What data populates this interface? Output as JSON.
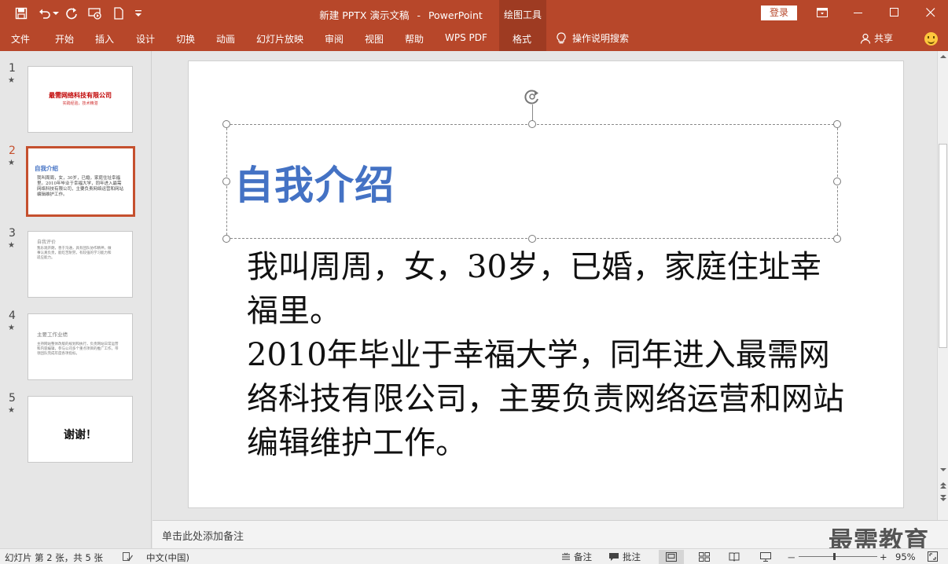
{
  "titlebar": {
    "doc_name": "新建 PPTX 演示文稿",
    "separator": "-",
    "app_name": "PowerPoint",
    "contextual_group": "绘图工具",
    "login_label": "登录"
  },
  "ribbon": {
    "tabs": [
      "文件",
      "开始",
      "插入",
      "设计",
      "切换",
      "动画",
      "幻灯片放映",
      "审阅",
      "视图",
      "帮助",
      "WPS PDF",
      "格式"
    ],
    "active_tab": "格式",
    "search_label": "操作说明搜索",
    "share_label": "共享"
  },
  "thumbnails": [
    {
      "number": "1",
      "star": "★",
      "title": "最需网络科技有限公司",
      "subtitle": "实践经验，技术精湛"
    },
    {
      "number": "2",
      "star": "★",
      "title": "自我介绍",
      "body": "我叫周周，女，30岁，已婚，家庭住址幸福里。2010年毕业于幸福大学，同年进入最需网络科技有限公司，主要负责网络运营和网站编辑维护工作。"
    },
    {
      "number": "3",
      "star": "★",
      "title": "自我评价",
      "body": "我乐观开朗，善于沟通，具有团队协作精神，做事认真负责，能吃苦耐劳，有较强的学习能力和适应能力。"
    },
    {
      "number": "4",
      "star": "★",
      "title": "主要工作业绩",
      "body": "主持网站整体改版的规划和执行，负责网站日常运营和内容编辑，参与公司多个重点项目的推广工作，带领团队完成年度各项指标。"
    },
    {
      "number": "5",
      "star": "★",
      "title": "谢谢！"
    }
  ],
  "slide": {
    "title": "自我介绍",
    "body_line1": "我叫周周，女，30岁，已婚，家庭住址幸福里。",
    "body_line2": "2010年毕业于幸福大学，同年进入最需网络科技有限公司，主要负责网络运营和网站编辑维护工作。",
    "title_color": "#4472c4"
  },
  "notes": {
    "placeholder": "单击此处添加备注",
    "watermark": "最需教育"
  },
  "statusbar": {
    "slide_info": "幻灯片 第 2 张，共 5 张",
    "language": "中文(中国)",
    "notes_label": "备注",
    "comments_label": "批注",
    "zoom_minus": "－",
    "zoom_plus": "+",
    "zoom_level": "95%",
    "zoom_fraction": 0.45
  },
  "colors": {
    "brand": "#b7472a",
    "active_thumb_border": "#c5502e"
  }
}
